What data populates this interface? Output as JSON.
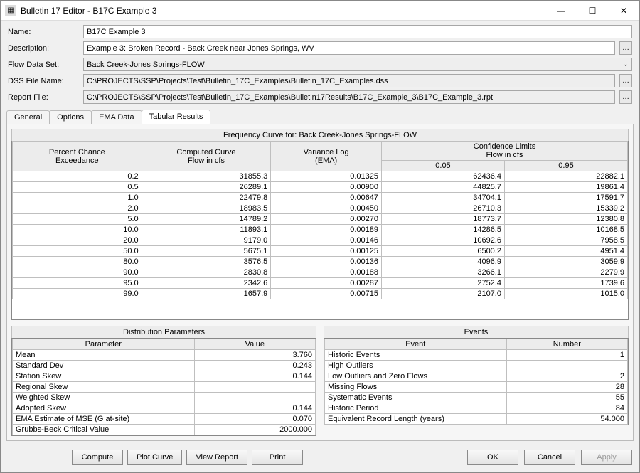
{
  "window": {
    "title": "Bulletin 17 Editor - B17C Example 3"
  },
  "form": {
    "name_label": "Name:",
    "name_value": "B17C Example 3",
    "desc_label": "Description:",
    "desc_value": "Example 3: Broken Record - Back Creek near Jones Springs, WV",
    "flowdata_label": "Flow Data Set:",
    "flowdata_value": "Back Creek-Jones Springs-FLOW",
    "dss_label": "DSS File Name:",
    "dss_value": "C:\\PROJECTS\\SSP\\Projects\\Test\\Bulletin_17C_Examples\\Bulletin_17C_Examples.dss",
    "report_label": "Report File:",
    "report_value": "C:\\PROJECTS\\SSP\\Projects\\Test\\Bulletin_17C_Examples\\Bulletin17Results\\B17C_Example_3\\B17C_Example_3.rpt",
    "browse": "…"
  },
  "tabs": {
    "general": "General",
    "options": "Options",
    "ema": "EMA Data",
    "tabular": "Tabular Results"
  },
  "freq": {
    "caption": "Frequency Curve for: Back Creek-Jones Springs-FLOW",
    "h_pct1": "Percent Chance",
    "h_pct2": "Exceedance",
    "h_comp1": "Computed Curve",
    "h_comp2": "Flow in cfs",
    "h_var1": "Variance Log",
    "h_var2": "(EMA)",
    "h_conf": "Confidence Limits",
    "h_conf_sub": "Flow in cfs",
    "h_c05": "0.05",
    "h_c95": "0.95",
    "rows": [
      {
        "p": "0.2",
        "c": "31855.3",
        "v": "0.01325",
        "l": "62436.4",
        "u": "22882.1"
      },
      {
        "p": "0.5",
        "c": "26289.1",
        "v": "0.00900",
        "l": "44825.7",
        "u": "19861.4"
      },
      {
        "p": "1.0",
        "c": "22479.8",
        "v": "0.00647",
        "l": "34704.1",
        "u": "17591.7"
      },
      {
        "p": "2.0",
        "c": "18983.5",
        "v": "0.00450",
        "l": "26710.3",
        "u": "15339.2"
      },
      {
        "p": "5.0",
        "c": "14789.2",
        "v": "0.00270",
        "l": "18773.7",
        "u": "12380.8"
      },
      {
        "p": "10.0",
        "c": "11893.1",
        "v": "0.00189",
        "l": "14286.5",
        "u": "10168.5"
      },
      {
        "p": "20.0",
        "c": "9179.0",
        "v": "0.00146",
        "l": "10692.6",
        "u": "7958.5"
      },
      {
        "p": "50.0",
        "c": "5675.1",
        "v": "0.00125",
        "l": "6500.2",
        "u": "4951.4"
      },
      {
        "p": "80.0",
        "c": "3576.5",
        "v": "0.00136",
        "l": "4096.9",
        "u": "3059.9"
      },
      {
        "p": "90.0",
        "c": "2830.8",
        "v": "0.00188",
        "l": "3266.1",
        "u": "2279.9"
      },
      {
        "p": "95.0",
        "c": "2342.6",
        "v": "0.00287",
        "l": "2752.4",
        "u": "1739.6"
      },
      {
        "p": "99.0",
        "c": "1657.9",
        "v": "0.00715",
        "l": "2107.0",
        "u": "1015.0"
      }
    ]
  },
  "dist": {
    "caption": "Distribution Parameters",
    "h_param": "Parameter",
    "h_value": "Value",
    "rows": [
      {
        "p": "Mean",
        "v": "3.760"
      },
      {
        "p": "Standard Dev",
        "v": "0.243"
      },
      {
        "p": "Station Skew",
        "v": "0.144"
      },
      {
        "p": "Regional Skew",
        "v": ""
      },
      {
        "p": "Weighted Skew",
        "v": ""
      },
      {
        "p": "Adopted Skew",
        "v": "0.144"
      },
      {
        "p": "EMA Estimate of MSE (G at-site)",
        "v": "0.070"
      },
      {
        "p": "Grubbs-Beck Critical Value",
        "v": "2000.000"
      }
    ]
  },
  "events": {
    "caption": "Events",
    "h_event": "Event",
    "h_num": "Number",
    "rows": [
      {
        "e": "Historic Events",
        "n": "1"
      },
      {
        "e": "High Outliers",
        "n": ""
      },
      {
        "e": "Low Outliers and Zero Flows",
        "n": "2"
      },
      {
        "e": "Missing Flows",
        "n": "28"
      },
      {
        "e": "Systematic Events",
        "n": "55"
      },
      {
        "e": "Historic Period",
        "n": "84"
      },
      {
        "e": "Equivalent Record Length (years)",
        "n": "54.000"
      }
    ]
  },
  "buttons": {
    "compute": "Compute",
    "plot": "Plot Curve",
    "view": "View Report",
    "print": "Print",
    "ok": "OK",
    "cancel": "Cancel",
    "apply": "Apply"
  },
  "chart_data": {
    "type": "table",
    "title": "Frequency Curve for: Back Creek-Jones Springs-FLOW",
    "columns": [
      "Percent Chance Exceedance",
      "Computed Curve Flow in cfs",
      "Variance Log (EMA)",
      "Confidence Limits 0.05",
      "Confidence Limits 0.95"
    ],
    "rows": [
      [
        0.2,
        31855.3,
        0.01325,
        62436.4,
        22882.1
      ],
      [
        0.5,
        26289.1,
        0.009,
        44825.7,
        19861.4
      ],
      [
        1.0,
        22479.8,
        0.00647,
        34704.1,
        17591.7
      ],
      [
        2.0,
        18983.5,
        0.0045,
        26710.3,
        15339.2
      ],
      [
        5.0,
        14789.2,
        0.0027,
        18773.7,
        12380.8
      ],
      [
        10.0,
        11893.1,
        0.00189,
        14286.5,
        10168.5
      ],
      [
        20.0,
        9179.0,
        0.00146,
        10692.6,
        7958.5
      ],
      [
        50.0,
        5675.1,
        0.00125,
        6500.2,
        4951.4
      ],
      [
        80.0,
        3576.5,
        0.00136,
        4096.9,
        3059.9
      ],
      [
        90.0,
        2830.8,
        0.00188,
        3266.1,
        2279.9
      ],
      [
        95.0,
        2342.6,
        0.00287,
        2752.4,
        1739.6
      ],
      [
        99.0,
        1657.9,
        0.00715,
        2107.0,
        1015.0
      ]
    ]
  }
}
